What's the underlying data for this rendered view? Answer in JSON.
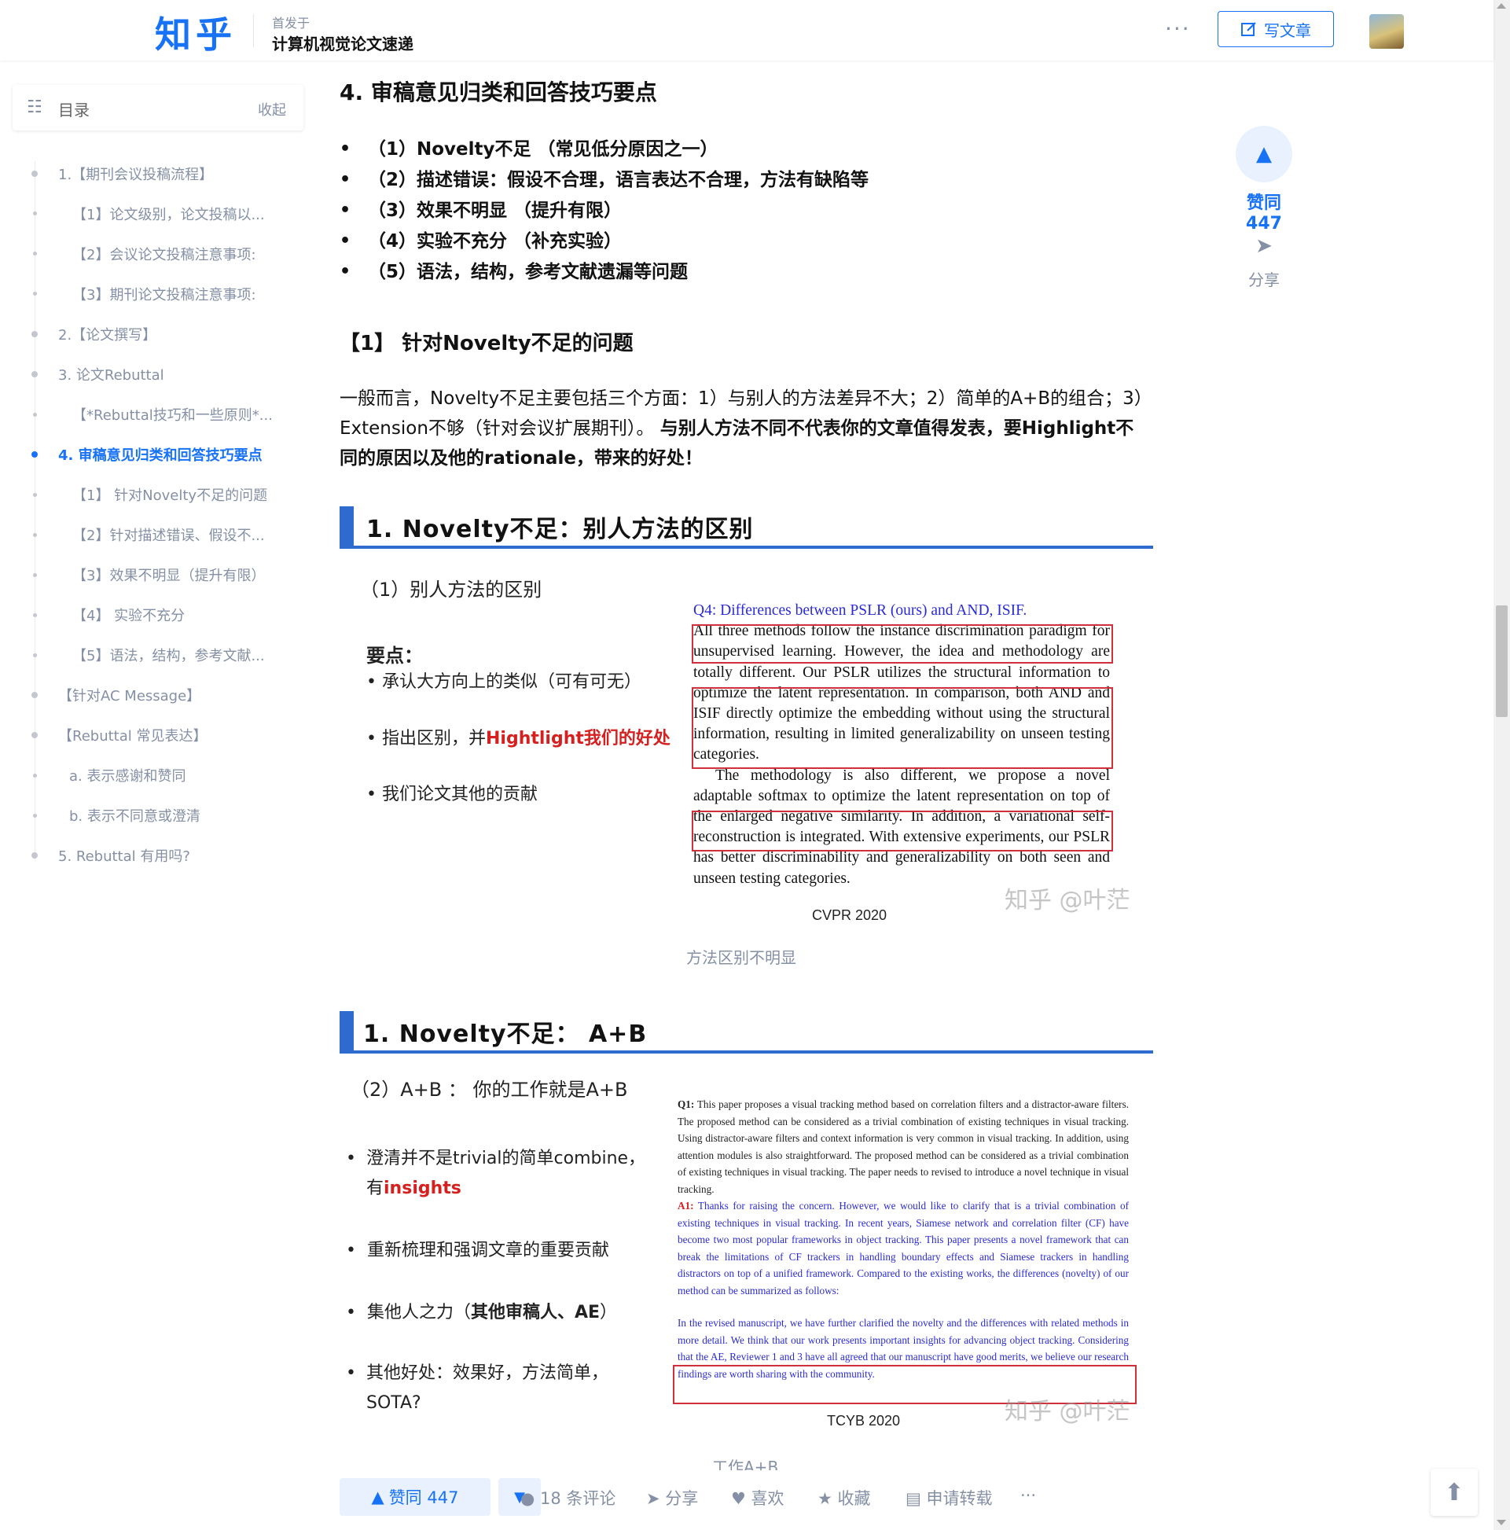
{
  "header": {
    "logo": "知乎",
    "published_prefix": "首发于",
    "column_name": "计算机视觉论文速递",
    "more": "···",
    "write_label": "写文章",
    "write_icon": "edit-icon"
  },
  "toc": {
    "title": "目录",
    "collapse": "收起",
    "items": [
      {
        "label": "1.【期刊会议投稿流程】",
        "level": 1
      },
      {
        "label": "【1】论文级别，论文投稿以...",
        "level": 2
      },
      {
        "label": "【2】会议论文投稿注意事项:",
        "level": 2
      },
      {
        "label": "【3】期刊论文投稿注意事项:",
        "level": 2
      },
      {
        "label": "2.【论文撰写】",
        "level": 1
      },
      {
        "label": "3. 论文Rebuttal",
        "level": 1
      },
      {
        "label": "【*Rebuttal技巧和一些原则*...",
        "level": 2
      },
      {
        "label": "4. 审稿意见归类和回答技巧要点",
        "level": 1,
        "active": true
      },
      {
        "label": "【1】 针对Novelty不足的问题",
        "level": 2
      },
      {
        "label": "【2】针对描述错误、假设不...",
        "level": 2
      },
      {
        "label": "【3】效果不明显（提升有限）",
        "level": 2
      },
      {
        "label": "【4】 实验不充分",
        "level": 2
      },
      {
        "label": "【5】语法，结构，参考文献...",
        "level": 2
      },
      {
        "label": "【针对AC Message】",
        "level": 1
      },
      {
        "label": "【Rebuttal 常见表达】",
        "level": 1
      },
      {
        "label": "a. 表示感谢和赞同",
        "level": 3
      },
      {
        "label": "b. 表示不同意或澄清",
        "level": 3
      },
      {
        "label": "5. Rebuttal 有用吗?",
        "level": 1
      }
    ]
  },
  "side_actions": {
    "vote_label": "赞同 447",
    "share_label": "分享"
  },
  "article": {
    "heading": "4. 审稿意见归类和回答技巧要点",
    "points": [
      "（1）Novelty不足 （常见低分原因之一）",
      "（2）描述错误：假设不合理，语言表达不合理，方法有缺陷等",
      "（3）效果不明显 （提升有限）",
      "（4）实验不充分 （补充实验）",
      "（5）语法，结构，参考文献遗漏等问题"
    ],
    "subheading": "【1】 针对Novelty不足的问题",
    "para_normal": "一般而言，Novelty不足主要包括三个方面：1）与别人的方法差异不大；2）简单的A+B的组合；3）Extension不够（针对会议扩展期刊）。",
    "para_bold": "与别人方法不同不代表你的文章值得发表，要Highlight不同的原因以及他的rationale，带来的好处！",
    "slide1": {
      "title": "1. Novelty不足：别人方法的区别",
      "sub": "（1）别人方法的区别",
      "key_label": "要点：",
      "b1": "承认大方向上的类似（可有可无）",
      "b2_prefix": "指出区别，并",
      "b2_red": "Hightlight我们的好处",
      "b3": "我们论文其他的贡献",
      "paper_q": "Q4: Differences between PSLR (ours) and AND, ISIF.",
      "paper_body": "All three methods follow the instance discrimination paradigm for unsupervised learning. However, the idea and methodology are totally different. Our PSLR utilizes the structural information to optimize the latent representation. In comparison, both AND and ISIF directly optimize the embedding without using the structural information, resulting in limited generalizability on unseen testing categories.",
      "paper_body2": "The methodology is also different, we propose a novel adaptable softmax to optimize the latent representation on top of the enlarged negative similarity. In addition, a variational self-reconstruction is integrated. With extensive experiments, our PSLR has better discriminability and generalizability on both seen and unseen testing categories.",
      "venue": "CVPR 2020",
      "watermark": "知乎 @叶茫",
      "caption": "方法区别不明显"
    },
    "slide2": {
      "title": "1. Novelty不足： A+B",
      "sub": "（2）A+B ： 你的工作就是A+B",
      "b1_prefix": "澄清并不是trivial的简单combine，有",
      "b1_red": "insights",
      "b2": "重新梳理和强调文章的重要贡献",
      "b3_prefix": "集他人之力（",
      "b3_bold": "其他审稿人、AE",
      "b3_suffix": "）",
      "b4": "其他好处：效果好，方法简单，SOTA?",
      "q1_label": "Q1:",
      "q1_text": "This paper proposes a visual tracking method based on correlation filters and a distractor-aware filters. The proposed method can be considered as a trivial combination of existing techniques in visual tracking. Using distractor-aware filters and context information is very common in visual tracking. In addition, using attention modules is also straightforward. The proposed method can be considered as a trivial combination of existing techniques in visual tracking. The paper needs to revised to introduce a novel technique in visual tracking.",
      "a1_label": "A1:",
      "a1_text": "Thanks for raising the concern. However, we would like to clarify that is a trivial combination of existing techniques in visual tracking. In recent years, Siamese network and correlation filter (CF) have become two most popular frameworks in object tracking. This paper presents a novel framework that can break the limitations of CF trackers in handling boundary effects and Siamese trackers in handling distractors on top of a unified framework. Compared to the existing works, the differences (novelty) of our method can be summarized as follows:",
      "revised_text": "In the revised manuscript, we have further clarified the novelty and the differences with related methods in more detail. We think that our work presents important insights for advancing object tracking. Considering that the AE, Reviewer 1 and 3 have all agreed that our manuscript have good merits, we believe our research findings are worth sharing with the community.",
      "venue": "TCYB 2020",
      "watermark": "知乎 @叶茫",
      "caption": "工作A+B"
    }
  },
  "bottom_bar": {
    "upvote": "赞同 447",
    "comments": "18 条评论",
    "share": "分享",
    "like": "喜欢",
    "collect": "收藏",
    "reprint": "申请转载",
    "more": "···"
  },
  "colors": {
    "brand_blue": "#1772f6",
    "slide_blue": "#2f6bcf",
    "highlight_red": "#d62020"
  }
}
